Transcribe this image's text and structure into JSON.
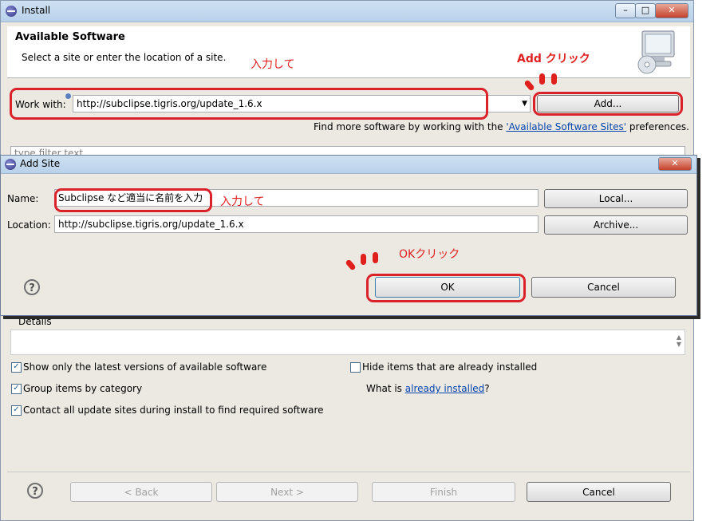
{
  "install": {
    "title": "Install",
    "header_title": "Available Software",
    "header_subtitle": "Select a site or enter the location of a site.",
    "work_with_label": "Work with:",
    "work_with_value": "http://subclipse.tigris.org/update_1.6.x",
    "add_button": "Add...",
    "find_more_prefix": "Find more software by working with the ",
    "find_more_link": "'Available Software Sites'",
    "find_more_suffix": " preferences.",
    "filter_placeholder": "type filter text",
    "details_label": "Details",
    "options": {
      "show_latest": "Show only the latest versions of available software",
      "group_by_category": "Group items by category",
      "contact_all": "Contact all update sites during install to find required software",
      "hide_installed": "Hide items that are already installed",
      "what_is_prefix": "What is ",
      "what_is_link": "already installed",
      "what_is_suffix": "?"
    },
    "footer": {
      "back": "< Back",
      "next": "Next >",
      "finish": "Finish",
      "cancel": "Cancel"
    }
  },
  "add_site": {
    "title": "Add Site",
    "name_label": "Name:",
    "name_value": "Subclipse など適当に名前を入力",
    "location_label": "Location:",
    "location_value": "http://subclipse.tigris.org/update_1.6.x",
    "local_button": "Local...",
    "archive_button": "Archive...",
    "ok_button": "OK",
    "cancel_button": "Cancel"
  },
  "annotations": {
    "input_here_1": "入力して",
    "add_click": "Add クリック",
    "input_here_2": "入力して",
    "ok_click": "OKクリック"
  },
  "colors": {
    "annotation_red": "#e02020",
    "link_blue": "#0645ad"
  }
}
